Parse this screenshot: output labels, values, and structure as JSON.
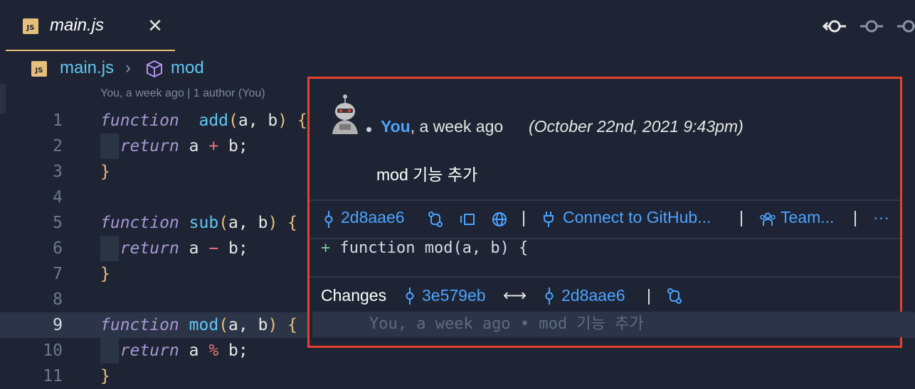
{
  "tab": {
    "badge": "JS",
    "title": "main.js",
    "close": "✕"
  },
  "breadcrumb": {
    "badge": "JS",
    "file": "main.js",
    "separator": "›",
    "symbol": "mod"
  },
  "blame_header": "You, a week ago | 1 author (You)",
  "lines": [
    {
      "n": "1",
      "parts": [
        [
          "kw-fn",
          "function"
        ],
        [
          "",
          "  "
        ],
        [
          "fname",
          "add"
        ],
        [
          "paren",
          "("
        ],
        [
          "",
          "a, b"
        ],
        [
          "paren",
          ")"
        ],
        [
          "",
          " "
        ],
        [
          "paren",
          "{"
        ]
      ]
    },
    {
      "n": "2",
      "indent": true,
      "parts": [
        [
          "",
          "  "
        ],
        [
          "kw-ret",
          "return"
        ],
        [
          "",
          " a "
        ],
        [
          "op",
          "+"
        ],
        [
          "",
          " b;"
        ]
      ]
    },
    {
      "n": "3",
      "parts": [
        [
          "paren",
          "}"
        ]
      ]
    },
    {
      "n": "4",
      "parts": []
    },
    {
      "n": "5",
      "parts": [
        [
          "kw-fn",
          "function"
        ],
        [
          "",
          " "
        ],
        [
          "fname",
          "sub"
        ],
        [
          "paren",
          "("
        ],
        [
          "",
          "a, b"
        ],
        [
          "paren",
          ")"
        ],
        [
          "",
          " "
        ],
        [
          "paren",
          "{"
        ]
      ]
    },
    {
      "n": "6",
      "indent": true,
      "parts": [
        [
          "",
          "  "
        ],
        [
          "kw-ret",
          "return"
        ],
        [
          "",
          " a "
        ],
        [
          "op",
          "−"
        ],
        [
          "",
          " b;"
        ]
      ]
    },
    {
      "n": "7",
      "parts": [
        [
          "paren",
          "}"
        ]
      ]
    },
    {
      "n": "8",
      "parts": []
    },
    {
      "n": "9",
      "current": true,
      "parts": [
        [
          "kw-fn",
          "function"
        ],
        [
          "",
          " "
        ],
        [
          "fname",
          "mod"
        ],
        [
          "paren",
          "("
        ],
        [
          "",
          "a, b"
        ],
        [
          "paren",
          ")"
        ],
        [
          "",
          " "
        ],
        [
          "paren",
          "{"
        ]
      ]
    },
    {
      "n": "10",
      "indent": true,
      "parts": [
        [
          "",
          "  "
        ],
        [
          "kw-ret",
          "return"
        ],
        [
          "",
          " a "
        ],
        [
          "op",
          "%"
        ],
        [
          "",
          " b;"
        ]
      ]
    },
    {
      "n": "11",
      "parts": [
        [
          "paren",
          "}"
        ]
      ]
    }
  ],
  "popup": {
    "author": "You",
    "relative_time": ", a week ago",
    "date": "(October 22nd, 2021 9:43pm)",
    "message": "mod 기능 추가",
    "actions": {
      "sha": "2d8aae6",
      "pipe": "|",
      "connect": "Connect to GitHub...",
      "team": "Team...",
      "more": "···"
    },
    "diff_plus": "+",
    "diff_line": "function mod(a, b) {",
    "changes": {
      "label": "Changes",
      "from_sha": "3e579eb",
      "arrow": "⟷",
      "to_sha": "2d8aae6",
      "pipe": "|"
    }
  },
  "inline_blame": "You, a week ago • mod 기능 추가",
  "colors": {
    "accent": "#4da3ff",
    "highlight_border": "#e8412e",
    "background": "#1e2433"
  }
}
